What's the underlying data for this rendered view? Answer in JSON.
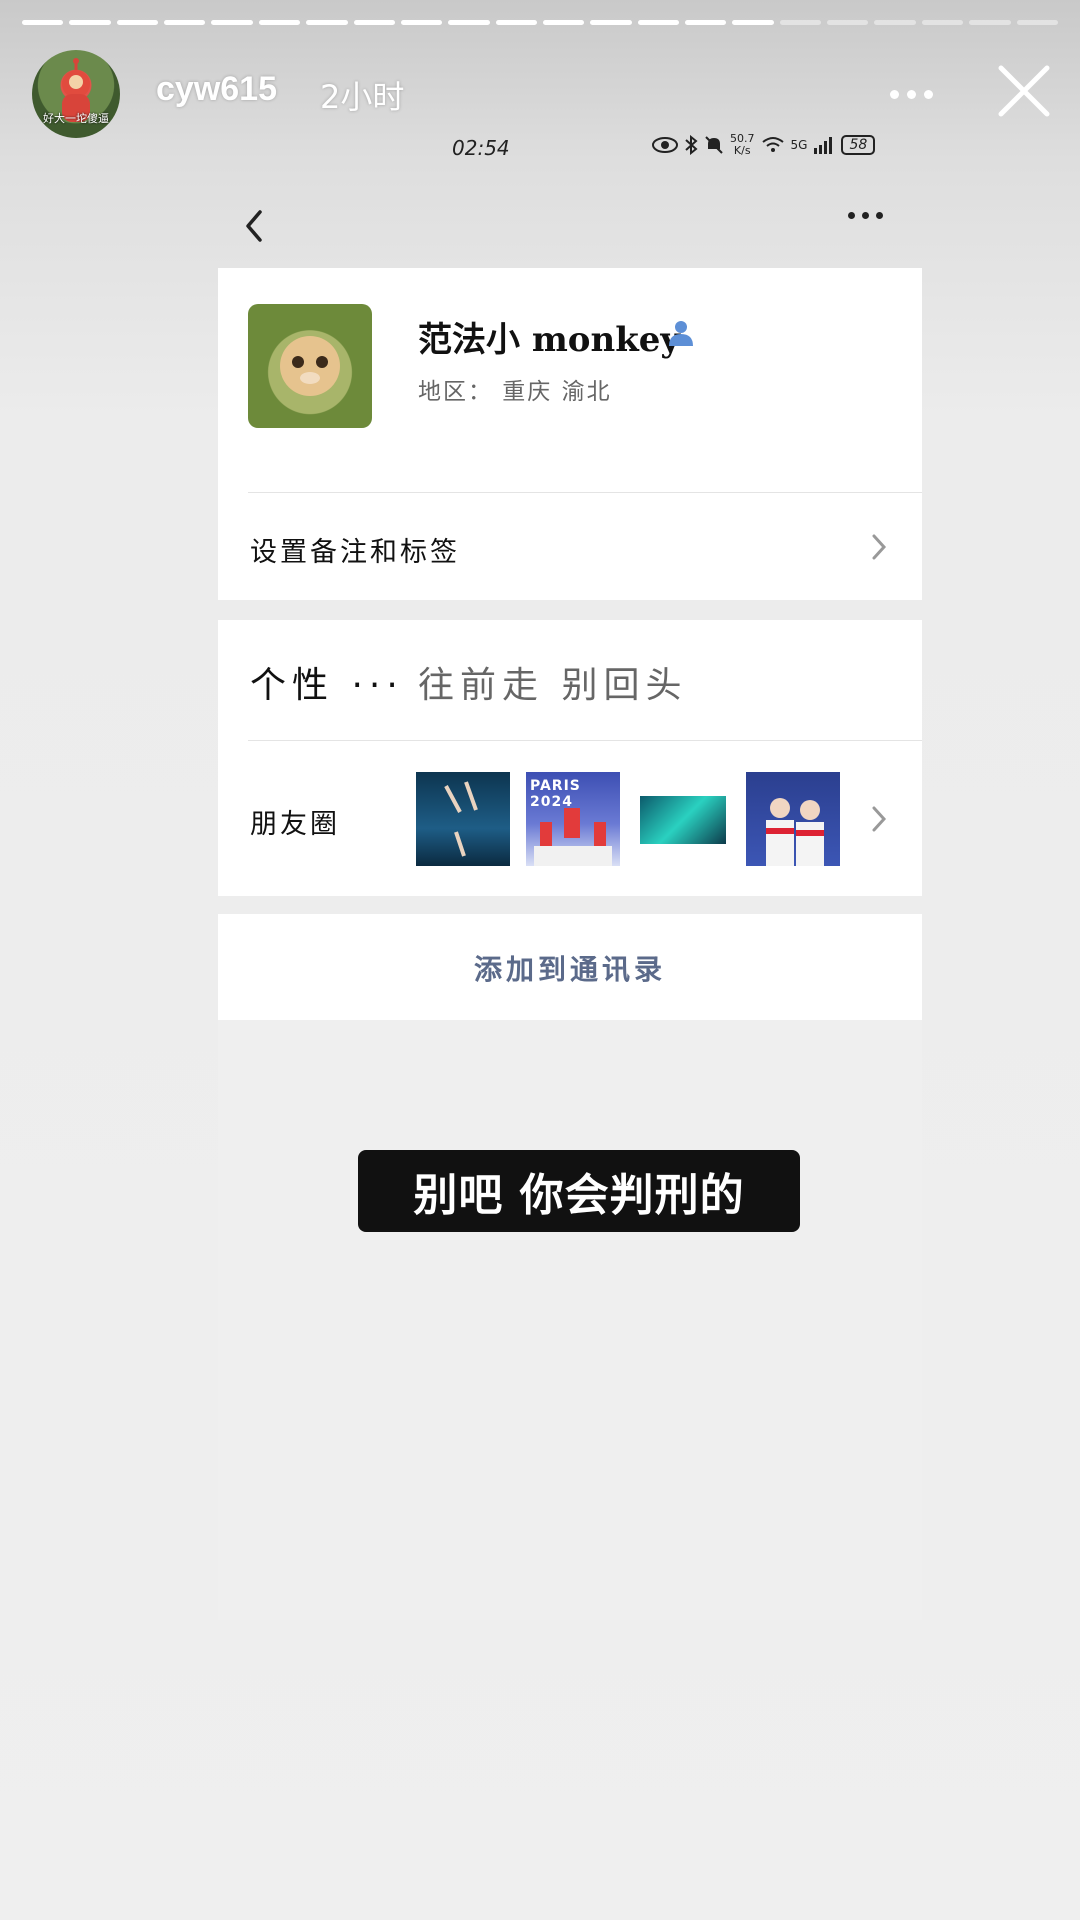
{
  "story": {
    "username": "cyw615",
    "time_ago": "2小时",
    "avatar_caption": "好大一坨傻逼",
    "progress": {
      "total_segments": 22,
      "completed_segments": 16
    },
    "more_icon": "more-horizontal-icon",
    "close_icon": "close-icon"
  },
  "phone_status_bar": {
    "time": "02:54",
    "net_speed": "50.7\nK/s",
    "network": "5G",
    "battery": "58"
  },
  "contact_profile": {
    "nickname": "范法小 monkey",
    "region": "地区： 重庆  渝北",
    "remark_row_label": "设置备注和标签",
    "signature_label": "个性 ···",
    "signature_value": "往前走 别回头",
    "moments_label": "朋友圈",
    "moments_thumbnails": [
      {
        "name": "diving-photo",
        "text": ""
      },
      {
        "name": "paris-podium-photo",
        "text": "PARIS 2024"
      },
      {
        "name": "screen-photo",
        "text": ""
      },
      {
        "name": "athletes-photo",
        "text": ""
      }
    ],
    "add_to_contacts": "添加到通讯录"
  },
  "caption_text": "别吧 你会判刑的",
  "colors": {
    "link_blue_gray": "#5b6a8a",
    "user_icon_blue": "#5d8fd6",
    "caption_bg": "#111111"
  }
}
